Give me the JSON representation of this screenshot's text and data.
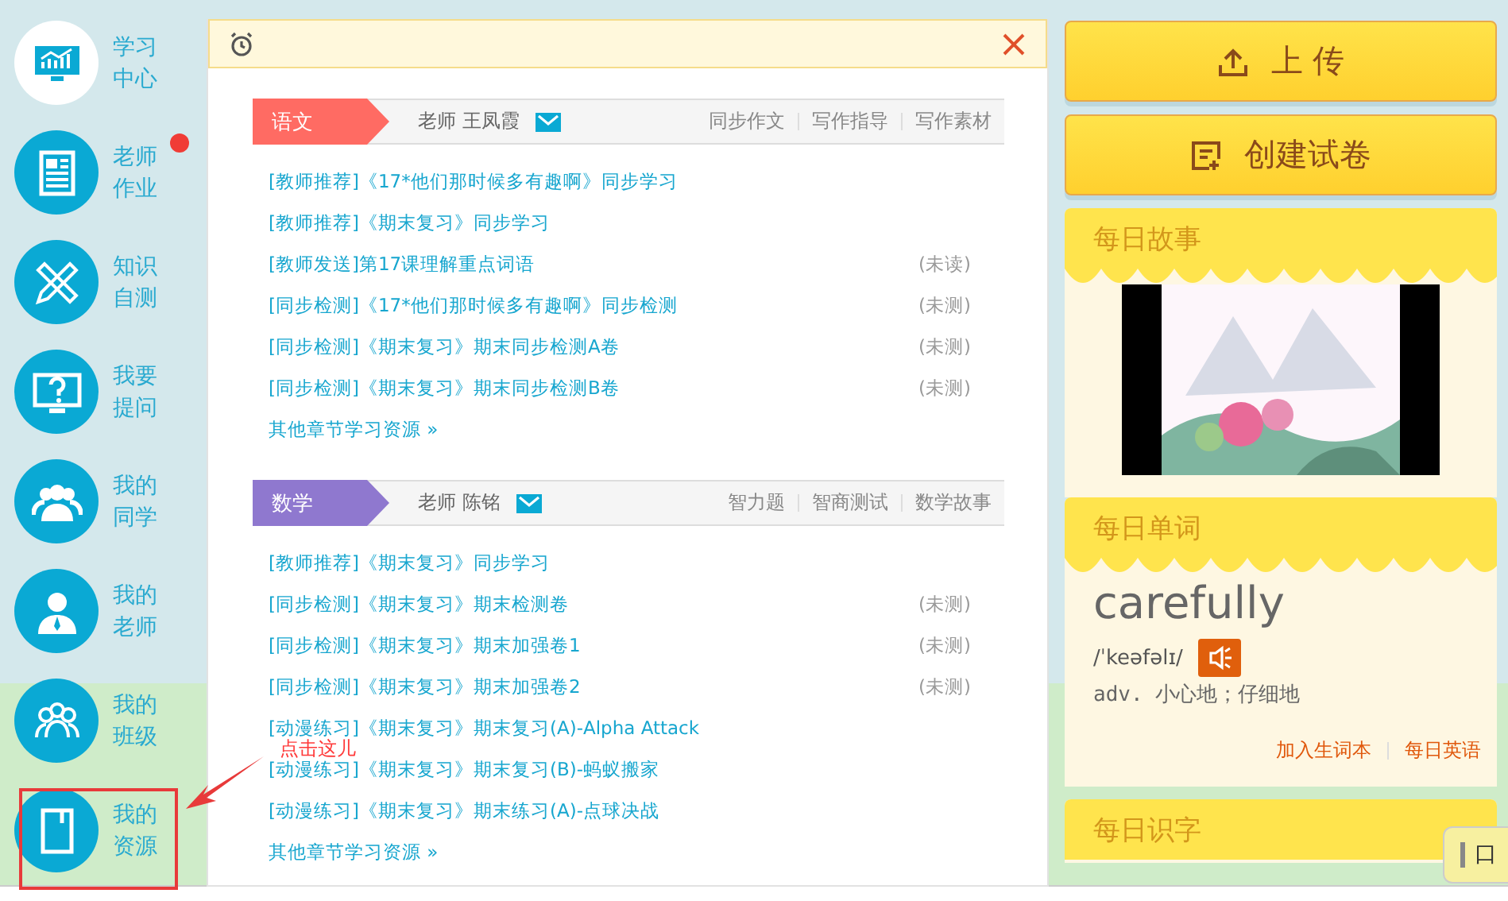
{
  "sidebar": {
    "items": [
      {
        "kind": "chart",
        "label": "学习中心",
        "selected": true,
        "badge": false
      },
      {
        "kind": "document",
        "label": "老师作业",
        "selected": false,
        "badge": true
      },
      {
        "kind": "ruler",
        "label": "知识自测",
        "selected": false,
        "badge": false
      },
      {
        "kind": "question",
        "label": "我要提问",
        "selected": false,
        "badge": false
      },
      {
        "kind": "classmates",
        "label": "我的同学",
        "selected": false,
        "badge": false
      },
      {
        "kind": "teacher",
        "label": "我的老师",
        "selected": false,
        "badge": false
      },
      {
        "kind": "class",
        "label": "我的班级",
        "selected": false,
        "badge": false
      },
      {
        "kind": "book",
        "label": "我的资源",
        "selected": false,
        "badge": false
      }
    ]
  },
  "sections": [
    {
      "subject": "语文",
      "color": "#ff6b63",
      "teacher": "老师 王凤霞",
      "links": [
        "同步作文",
        "写作指导",
        "写作素材"
      ],
      "items": [
        {
          "text": "[教师推荐]《17*他们那时候多有趣啊》同步学习"
        },
        {
          "text": "[教师推荐]《期末复习》同步学习"
        },
        {
          "text": "[教师发送]第17课理解重点词语",
          "status": "(未读)"
        },
        {
          "text": "[同步检测]《17*他们那时候多有趣啊》同步检测",
          "status": "(未测)"
        },
        {
          "text": "[同步检测]《期末复习》期末同步检测A卷",
          "status": "(未测)"
        },
        {
          "text": "[同步检测]《期末复习》期末同步检测B卷",
          "status": "(未测)"
        }
      ],
      "more": "其他章节学习资源 »"
    },
    {
      "subject": "数学",
      "color": "#8f78cf",
      "teacher": "老师 陈铭",
      "links": [
        "智力题",
        "智商测试",
        "数学故事"
      ],
      "items": [
        {
          "text": "[教师推荐]《期末复习》同步学习"
        },
        {
          "text": "[同步检测]《期末复习》期末检测卷",
          "status": "(未测)"
        },
        {
          "text": "[同步检测]《期末复习》期末加强卷1",
          "status": "(未测)"
        },
        {
          "text": "[同步检测]《期末复习》期末加强卷2",
          "status": "(未测)"
        },
        {
          "text": "[动漫练习]《期末复习》期末复习(A)-Alpha Attack"
        },
        {
          "text": "[动漫练习]《期末复习》期末复习(B)-蚂蚁搬家"
        },
        {
          "text": "[动漫练习]《期末复习》期末练习(A)-点球决战"
        }
      ],
      "more": "其他章节学习资源 »"
    }
  ],
  "actions": [
    {
      "kind": "upload",
      "label": "上 传"
    },
    {
      "kind": "create",
      "label": "创建试卷"
    }
  ],
  "story": {
    "title": "每日故事"
  },
  "word": {
    "title": "每日单词",
    "word": "carefully",
    "phonetic": "/ˈkeəfəlɪ/",
    "meaning": "adv. 小心地；仔细地",
    "links": [
      "加入生词本",
      "每日英语"
    ]
  },
  "character": {
    "title": "每日识字"
  },
  "annotation": {
    "text": "点击这儿"
  },
  "floating_widget": {
    "text": "口"
  }
}
